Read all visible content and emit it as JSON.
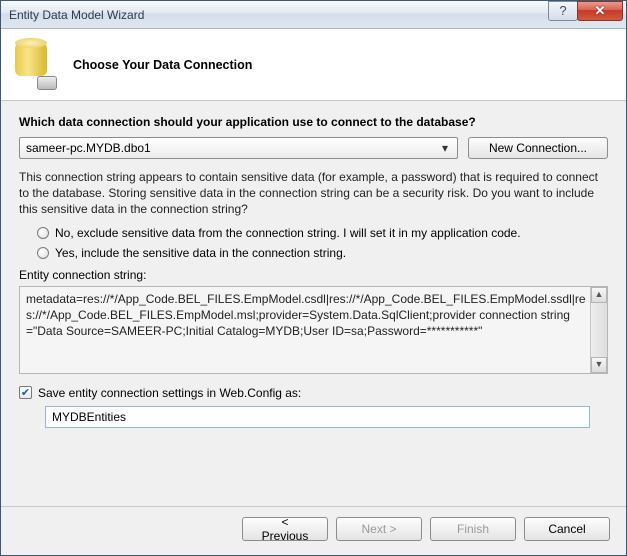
{
  "window": {
    "title": "Entity Data Model Wizard"
  },
  "header": {
    "title": "Choose Your Data Connection"
  },
  "prompt": "Which data connection should your application use to connect to the database?",
  "connection": {
    "selected": "sameer-pc.MYDB.dbo1",
    "new_button": "New Connection..."
  },
  "explain": "This connection string appears to contain sensitive data (for example, a password) that is required to connect to the database. Storing sensitive data in the connection string can be a security risk. Do you want to include this sensitive data in the connection string?",
  "radios": {
    "exclude": "No, exclude sensitive data from the connection string. I will set it in my application code.",
    "include": "Yes, include the sensitive data in the connection string."
  },
  "conn_string_label": "Entity connection string:",
  "conn_string_value": "metadata=res://*/App_Code.BEL_FILES.EmpModel.csdl|res://*/App_Code.BEL_FILES.EmpModel.ssdl|res://*/App_Code.BEL_FILES.EmpModel.msl;provider=System.Data.SqlClient;provider connection string=\"Data Source=SAMEER-PC;Initial Catalog=MYDB;User ID=sa;Password=***********\"",
  "save_checkbox_label": "Save entity connection settings in Web.Config as:",
  "save_name_value": "MYDBEntities",
  "buttons": {
    "previous": "< Previous",
    "next": "Next >",
    "finish": "Finish",
    "cancel": "Cancel"
  }
}
